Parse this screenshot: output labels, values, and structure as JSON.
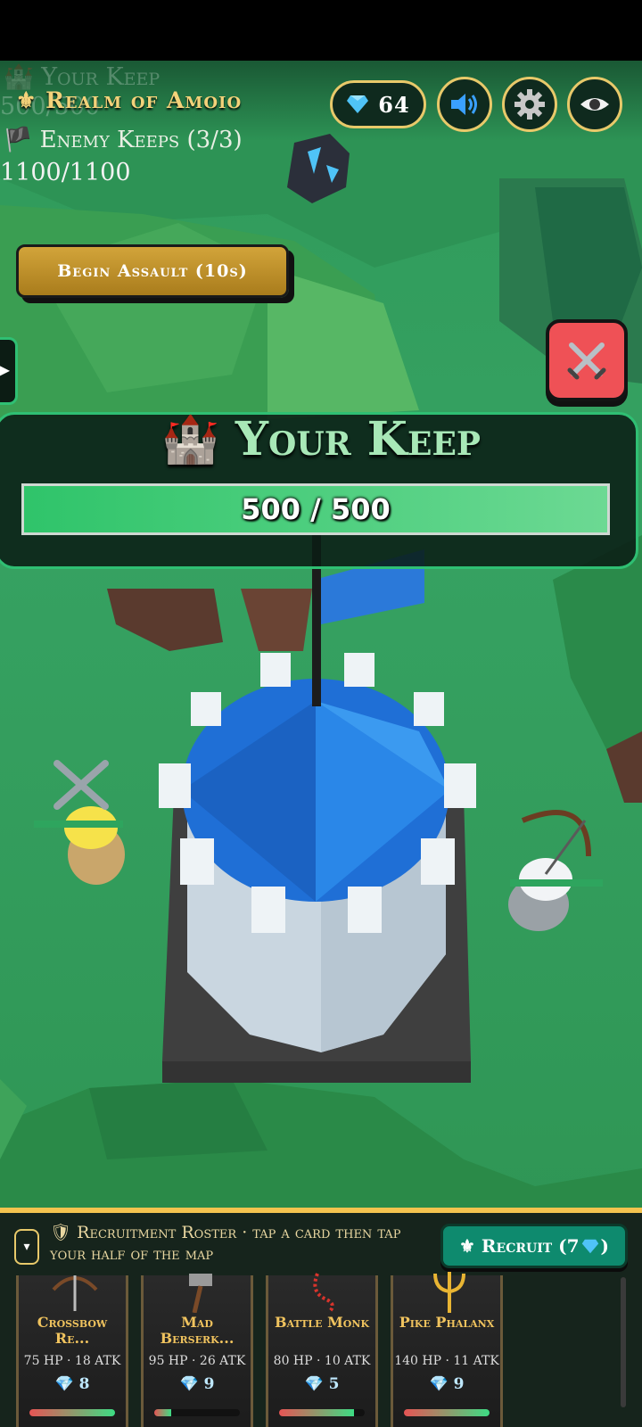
{
  "header": {
    "ghost_title": "Your Keep",
    "ghost_hp": "500/500",
    "realm_title": "Realm of Amoio",
    "enemy_keeps_label": "Enemy Keeps (3/3)",
    "enemy_hp": "1100/1100",
    "gems": "64",
    "icons": [
      "gem-icon",
      "speaker-icon",
      "gear-icon",
      "eye-icon"
    ]
  },
  "assault_button": "Begin Assault (10s)",
  "side_tab_arrow": "▶",
  "keep": {
    "title": "Your Keep",
    "hp_text": "500 / 500",
    "hp_fraction": 1.0
  },
  "roster": {
    "toggle": "▾",
    "text": "Recruitment Roster · tap a card then tap your half of the map",
    "recruit_label": "Recruit (7",
    "recruit_suffix": ")"
  },
  "cards": [
    {
      "name": "Crossbow Re...",
      "stats": "75 HP · 18 ATK",
      "cost": "8",
      "bar_fraction": 1.0,
      "icon": "crossbow-icon"
    },
    {
      "name": "Mad Berserk...",
      "stats": "95 HP · 26 ATK",
      "cost": "9",
      "bar_fraction": 0.2,
      "icon": "hammer-icon"
    },
    {
      "name": "Battle Monk",
      "stats": "80 HP · 10 ATK",
      "cost": "5",
      "bar_fraction": 0.88,
      "icon": "prayer-beads-icon"
    },
    {
      "name": "Pike Phalanx",
      "stats": "140 HP · 11 ATK",
      "cost": "9",
      "bar_fraction": 1.0,
      "icon": "trident-icon"
    }
  ],
  "colors": {
    "accent_gold": "#e8c96a",
    "keep_green": "#2fbf73",
    "battle_red": "#ef5156",
    "recruit_teal": "#0e8a6e"
  }
}
